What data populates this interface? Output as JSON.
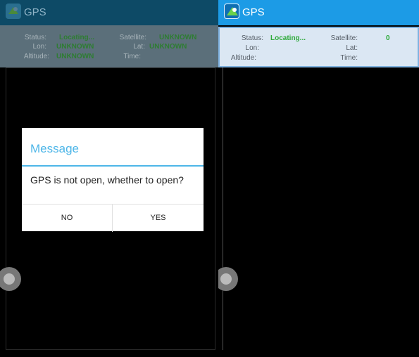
{
  "left_screen": {
    "app_title": "GPS",
    "info": {
      "status_label": "Status:",
      "status_value": "Locating...",
      "satellite_label": "Satellite:",
      "satellite_value": "UNKNOWN",
      "lon_label": "Lon:",
      "lon_value": "UNKNOWN",
      "lat_label": "Lat:",
      "lat_value": "UNKNOWN",
      "altitude_label": "Altitude:",
      "altitude_value": "UNKNOWN",
      "time_label": "Time:"
    },
    "dialog": {
      "title": "Message",
      "message": "GPS is not open, whether to open?",
      "no_label": "NO",
      "yes_label": "YES"
    }
  },
  "right_screen": {
    "app_title": "GPS",
    "info": {
      "status_label": "Status:",
      "status_value": "Locating...",
      "satellite_label": "Satellite:",
      "satellite_value": "0",
      "lon_label": "Lon:",
      "lat_label": "Lat:",
      "altitude_label": "Altitude:",
      "time_label": "Time:"
    }
  },
  "colors": {
    "dialog_accent": "#4db6e8",
    "right_appbar": "#1c9be6",
    "left_appbar_dimmed": "#0d4a66",
    "status_value_green": "#2eaa3a"
  },
  "icons": [
    "gps-app-icon",
    "edge-drag-handle"
  ]
}
